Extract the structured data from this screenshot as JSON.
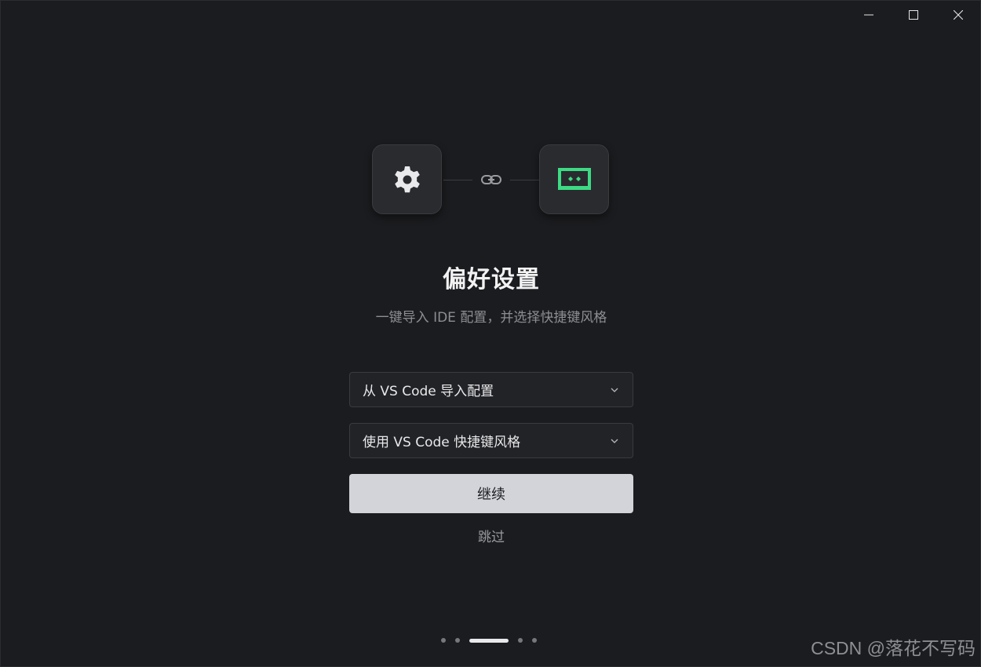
{
  "window": {
    "controls": [
      "minimize",
      "maximize",
      "close"
    ]
  },
  "hero": {
    "left_icon": "gear-icon",
    "middle_icon": "link-icon",
    "right_icon": "editor-logo-icon",
    "accent_color": "#3ddc84"
  },
  "onboarding": {
    "title": "偏好设置",
    "subtitle": "一键导入 IDE 配置，并选择快捷键风格",
    "import_select": {
      "value": "从 VS Code 导入配置"
    },
    "keymap_select": {
      "value": "使用 VS Code 快捷键风格"
    },
    "continue_label": "继续",
    "skip_label": "跳过"
  },
  "pager": {
    "total": 5,
    "current": 3
  },
  "watermark": "CSDN @落花不写码"
}
